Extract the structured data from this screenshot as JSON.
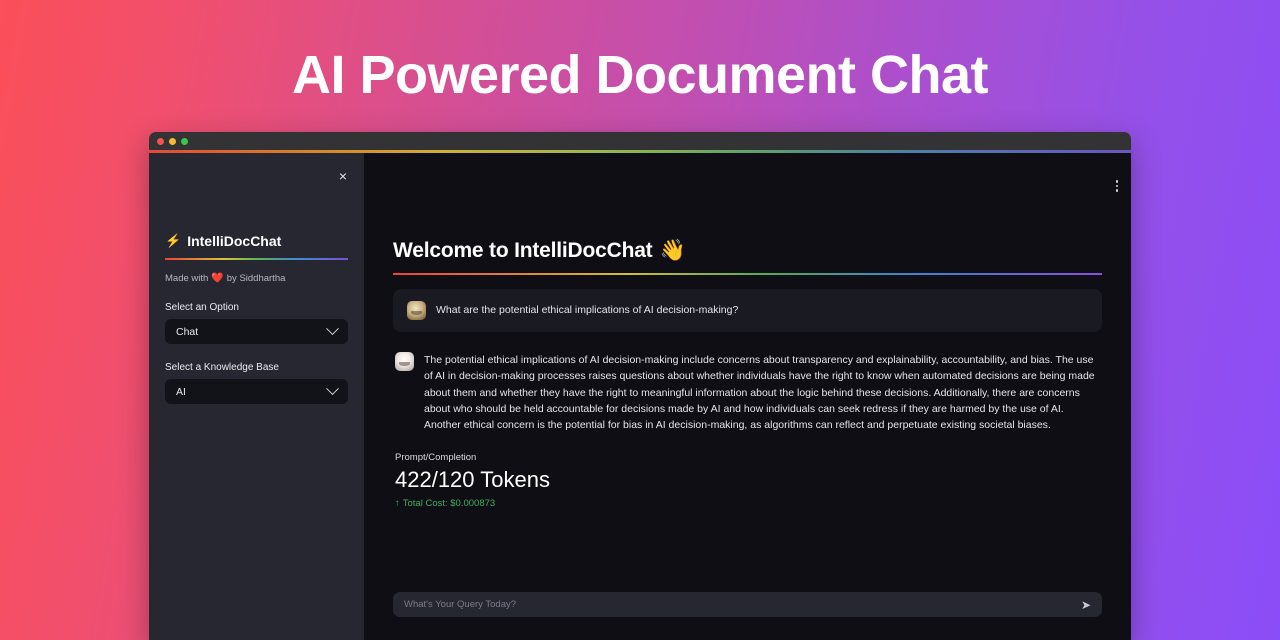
{
  "page": {
    "title": "AI Powered Document Chat"
  },
  "window": {
    "traffic_lights": [
      "close",
      "minimize",
      "maximize"
    ]
  },
  "sidebar": {
    "close_label": "×",
    "brand": {
      "icon": "⚡",
      "name": "IntelliDocChat"
    },
    "credit": {
      "prefix": "Made with",
      "heart": "❤️",
      "suffix": "by Siddhartha"
    },
    "fields": [
      {
        "label": "Select an Option",
        "value": "Chat",
        "options": [
          "Chat"
        ]
      },
      {
        "label": "Select a Knowledge Base",
        "value": "AI",
        "options": [
          "AI"
        ]
      }
    ]
  },
  "main": {
    "menu_icon": "kebab-menu",
    "heading": "Welcome to IntelliDocChat",
    "heading_emoji": "👋",
    "messages": [
      {
        "role": "user",
        "avatar": "user-avatar",
        "text": "What are the potential ethical implications of AI decision-making?"
      },
      {
        "role": "assistant",
        "avatar": "assistant-avatar",
        "text": "The potential ethical implications of AI decision-making include concerns about transparency and explainability, accountability, and bias. The use of AI in decision-making processes raises questions about whether individuals have the right to know when automated decisions are being made about them and whether they have the right to meaningful information about the logic behind these decisions. Additionally, there are concerns about who should be held accountable for decisions made by AI and how individuals can seek redress if they are harmed by the use of AI. Another ethical concern is the potential for bias in AI decision-making, as algorithms can reflect and perpetuate existing societal biases."
      }
    ],
    "metrics": {
      "caption": "Prompt/Completion",
      "tokens": "422/120 Tokens",
      "prompt_tokens": 422,
      "completion_tokens": 120,
      "cost_arrow": "↑",
      "cost_label": "Total Cost: $0.000873",
      "cost_color": "#3fae5f"
    },
    "composer": {
      "placeholder": "What's Your Query Today?",
      "value": "",
      "send_icon": "➤"
    }
  }
}
